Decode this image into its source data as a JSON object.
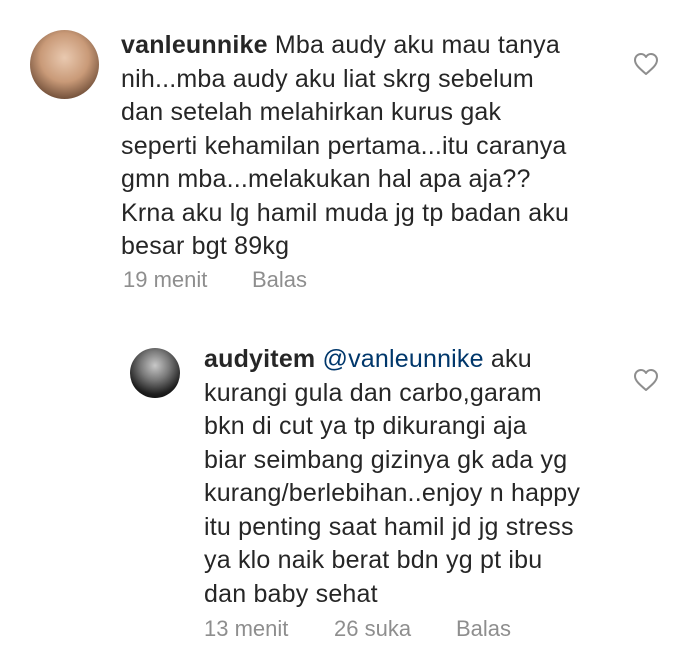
{
  "comments": [
    {
      "username": "vanleunnike",
      "lines": [
        "Mba audy aku mau tanya",
        "nih...mba audy aku liat skrg sebelum",
        "dan setelah melahirkan kurus gak",
        "seperti kehamilan pertama...itu caranya",
        "gmn mba...melakukan hal apa aja??",
        "Krna aku lg hamil muda jg tp badan aku",
        "besar bgt 89kg"
      ],
      "time": "19 menit",
      "reply_label": "Balas"
    },
    {
      "username": "audyitem",
      "mention": "@vanleunnike",
      "lines": [
        "aku",
        "kurangi gula dan carbo,garam",
        "bkn di cut ya tp dikurangi aja",
        "biar seimbang gizinya gk ada yg",
        "kurang/berlebihan..enjoy n happy",
        "itu penting saat hamil jd jg stress",
        "ya klo naik berat bdn yg pt ibu",
        "dan baby sehat"
      ],
      "time": "13 menit",
      "likes": "26 suka",
      "reply_label": "Balas"
    }
  ],
  "icons": {
    "like": "heart-outline-icon",
    "story_ring": "story-ring"
  },
  "colors": {
    "text": "#262626",
    "meta": "#8e8e8e",
    "mention": "#00376b",
    "heart": "#8e8e8e"
  }
}
